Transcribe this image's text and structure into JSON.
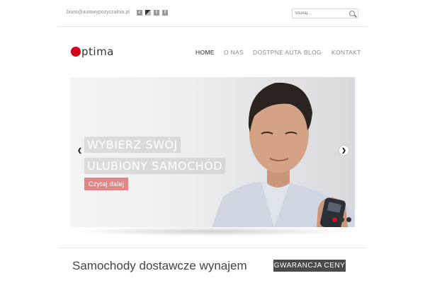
{
  "header": {
    "email": "biuro@autowypozyczalnia.pl",
    "social_icons": [
      "rss-icon",
      "delicious-icon",
      "twitter-icon",
      "facebook-icon"
    ],
    "search_placeholder": "Szukaj..."
  },
  "logo": {
    "text": "ptima",
    "brand_color": "#d0021b"
  },
  "nav": {
    "items": [
      {
        "label": "HOME",
        "active": true
      },
      {
        "label": "O NAS",
        "active": false
      },
      {
        "label": "DOSTPNE AUTA",
        "active": false
      },
      {
        "label": "BLOG",
        "active": false
      },
      {
        "label": "KONTAKT",
        "active": false
      }
    ]
  },
  "slider": {
    "caption_line1": "WYBIERZ SWÓJ",
    "caption_line2": "ULUBIONY SAMOCHÓD",
    "button_label": "Czytaj dalej",
    "prev_symbol": "❮",
    "next_symbol": "❯",
    "slide_count": 3,
    "active_slide": 1
  },
  "footer": {
    "title": "Samochody dostawcze wynajem",
    "badge": "GWARANCJA CENY"
  },
  "colors": {
    "accent": "#d0021b",
    "button_bg": "#e0878a",
    "badge_bg": "#4a4a4a"
  }
}
